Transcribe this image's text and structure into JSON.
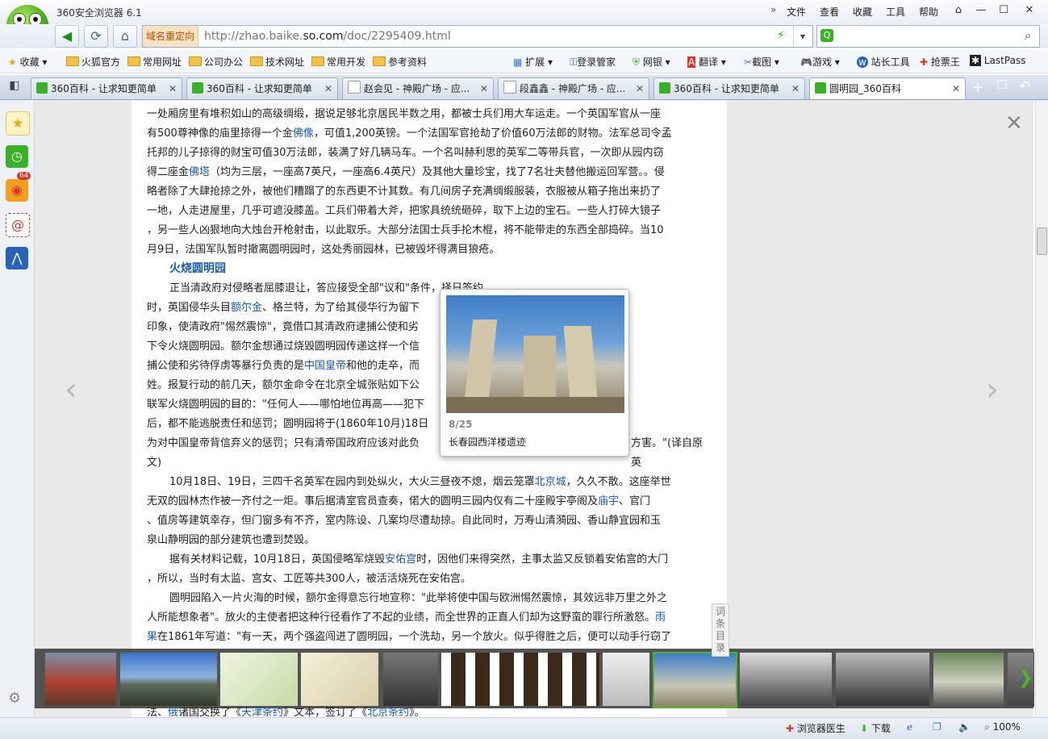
{
  "window": {
    "title": "360安全浏览器 6.1"
  },
  "menu": [
    "文件",
    "查看",
    "收藏",
    "工具",
    "帮助"
  ],
  "nav": {
    "redirect_label": "域名重定向",
    "url_prefix": "http://zhao.baike.",
    "url_domain": "so.com",
    "url_suffix": "/doc/2295409.html"
  },
  "bookmarks": {
    "favorites": "收藏",
    "items": [
      "火狐官方",
      "常用网址",
      "公司办公",
      "技术网址",
      "常用开发",
      "参考资料"
    ],
    "tools": [
      "扩展",
      "登录管家",
      "网银",
      "翻译",
      "截图",
      "游戏",
      "站长工具",
      "抢票王",
      "LastPass"
    ]
  },
  "tabs": [
    {
      "label": "360百科 - 让求知更简单",
      "icon": "360-search-icon"
    },
    {
      "label": "360百科 - 让求知更简单",
      "icon": "360-search-icon"
    },
    {
      "label": "赵会见 - 神殿广场 - 应...",
      "icon": "page-icon"
    },
    {
      "label": "段鑫鑫 - 神殿广场 - 应...",
      "icon": "page-icon"
    },
    {
      "label": "360百科 - 让求知更简单",
      "icon": "360-search-icon"
    },
    {
      "label": "圆明园_360百科",
      "icon": "360-search-icon"
    }
  ],
  "sidebar": {
    "weibo_badge": "64"
  },
  "article": {
    "p1": [
      "一处厢房里有堆积如山的高级绸缎，据说足够北京居民半数之用，都被士兵们用大车运走。一个英国军官从一座",
      "有500尊神像的庙里掠得一个金",
      "佛像",
      "，可值1,200英镑。一个法国军官抢劫了价值60万法郎的财物。法军总司令孟",
      "托邦的儿子掠得的财宝可值30万法郎，装满了好几辆马车。一个名叫赫利思的英军二等带兵官，一次即从园内窃",
      "得二座金",
      "佛塔",
      "（均为三层，一座高7英尺，一座高6.4英尺）及其他大量珍宝，找了7名壮夫替他搬运回军营。。侵",
      "略者除了大肆抢掠之外，被他们糟蹋了的东西更不计其数。有几间房子充满绸缎服装，衣服被从箱子拖出来扔了",
      "一地，人走进屋里，几乎可遮没膝盖。工兵们带着大斧，把家具统统砸碎，取下上边的宝石。一些人打碎大镜子",
      "，另一些人凶狠地向大烛台开枪射击，以此取乐。大部分法国士兵手抡木棍，将不能带走的东西全部捣碎。当10",
      "月9日，法国军队暂时撤离圆明园时，这处秀丽园林，已被毁坏得满目狼疮。"
    ],
    "section_title": "火烧圆明园",
    "p2": [
      "正当清政府对侵略者屈膝退让，答应接受全部\"议和\"条件，择日签约",
      "时，英国侵华头目",
      "额尔金",
      "、格兰特，为了给其侵华行为留下",
      "印象，使清政府\"惕然震惊\"，竟借口其清政府逮捕公使和劣",
      "下令火烧圆明园。额尔金想通过烧毁圆明园传递这样一个信",
      "捕公使和劣待俘虏等暴行负责的是",
      "中国皇帝",
      "和他的走卒，而",
      "姓。报复行动的前几天，额尔金命令在北京全城张贴如下公",
      "联军火烧圆明园的目的：\"任何人——哪怕地位再高——犯下",
      "后，都不能逃脱责任和惩罚；圆明园将于(1860年10月)18日",
      "为对中国皇帝背信弃义的惩罚；只有清帝国政府应该对此负",
      "方害。\"(译自原英",
      "文)"
    ],
    "p3": [
      "10月18日、19日，三四千名英军在园内到处纵火，大火三昼夜不熄，烟云笼罩",
      "北京城",
      "，久久不散。这座举世",
      "无双的园林杰作被一齐付之一炬。事后据清室官员查奏，偌大的圆明三园内仅有二十座殿宇亭阁及",
      "庙宇",
      "、官门",
      "、值房等建筑幸存，但门窗多有不齐，室内陈设、几案均尽遭劫掠。自此同时，万寿山清漪园、香山静宜园和玉",
      "泉山静明园的部分建筑也遭到焚毁。"
    ],
    "p4": [
      "据有关材料记载，10月18日，英国侵略军烧毁",
      "安佑宫",
      "时，因他们来得突然，主事太监又反锁着安佑宫的大门",
      "，所以，当时有太监、宫女、工匠等共300人，被活活烧死在安佑宫。"
    ],
    "p5": [
      "圆明园陷入一片火海的时候，额尔金得意忘行地宣称：\"此举将使中国与欧洲惕然震惊，其效远非万里之外之",
      "人所能想象者\"。放火的主使者把这种行径看作了不起的业绩，而全世界的正直人们却为这野蛮的罪行所激怒。",
      "雨",
      "果",
      "在1861年写道：\"有一天，两个强盗闯进了圆明园，一个洗劫，另一个放火。似乎得胜之后，便可以动手行窃了"
    ],
    "p6": [
      "法、",
      "俄",
      "诸国交换了《",
      "天津条约",
      "》文本，签订了《",
      "北京条约",
      "》。"
    ]
  },
  "popup": {
    "counter": "8/25",
    "caption": "长春园西洋楼遗迹"
  },
  "directory_tab": [
    "词",
    "条",
    "目",
    "录"
  ],
  "status": {
    "doctor": "浏览器医生",
    "download": "下载",
    "zoom": "100%"
  }
}
